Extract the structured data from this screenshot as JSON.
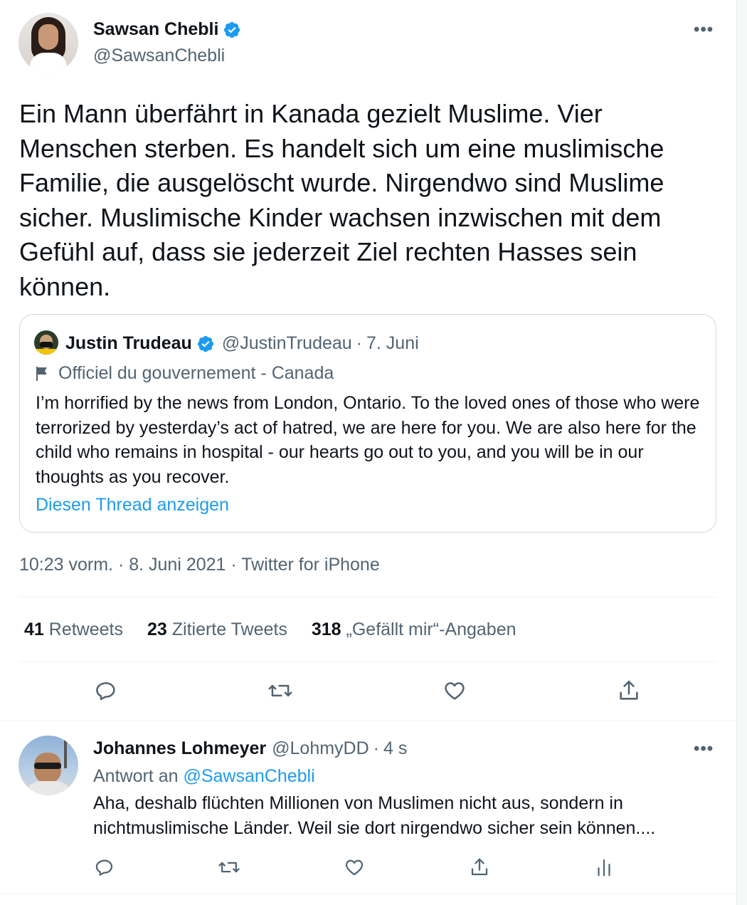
{
  "tweet": {
    "author": {
      "display_name": "Sawsan Chebli",
      "handle": "@SawsanChebli",
      "verified": true
    },
    "text": "Ein Mann überfährt in Kanada gezielt Muslime. Vier Menschen sterben. Es handelt sich um eine muslimische Familie, die ausgelöscht wurde. Nirgendwo sind Muslime sicher. Muslimische Kinder wachsen inzwischen mit dem Gefühl auf, dass sie jederzeit Ziel rechten Hasses sein können.",
    "more_icon": "more-horizontal-icon",
    "quote": {
      "display_name": "Justin Trudeau",
      "handle": "@JustinTrudeau",
      "separator": "·",
      "date": "7. Juni",
      "label": "Officiel du gouvernement - Canada",
      "label_icon": "flag-icon",
      "text": "I’m horrified by the news from London, Ontario. To the loved ones of those who were terrorized by yesterday’s act of hatred, we are here for you. We are also here for the child who remains in hospital - our hearts go out to you, and you will be in our thoughts as you recover.",
      "thread_link": "Diesen Thread anzeigen"
    },
    "meta": "10:23 vorm. · 8. Juni 2021 · Twitter for iPhone",
    "stats": [
      {
        "count": "41",
        "label": "Retweets"
      },
      {
        "count": "23",
        "label": "Zitierte Tweets"
      },
      {
        "count": "318",
        "label": "„Gefällt mir“-Angaben"
      }
    ],
    "actions": [
      "reply-icon",
      "retweet-icon",
      "like-icon",
      "share-icon"
    ]
  },
  "reply": {
    "display_name": "Johannes Lohmeyer",
    "handle": "@LohmyDD",
    "separator": "·",
    "time": "4 s",
    "reply_to_prefix": "Antwort an",
    "reply_to_handle": "@SawsanChebli",
    "text": "Aha, deshalb flüchten Millionen von Muslimen nicht aus, sondern in nichtmuslimische Länder. Weil sie dort nirgendwo sicher sein können....",
    "actions": [
      "reply-icon",
      "retweet-icon",
      "like-icon",
      "share-icon",
      "analytics-icon"
    ]
  },
  "colors": {
    "text": "#0f1419",
    "secondary": "#536471",
    "accent": "#1d9bf0",
    "border": "#cfd9de"
  }
}
